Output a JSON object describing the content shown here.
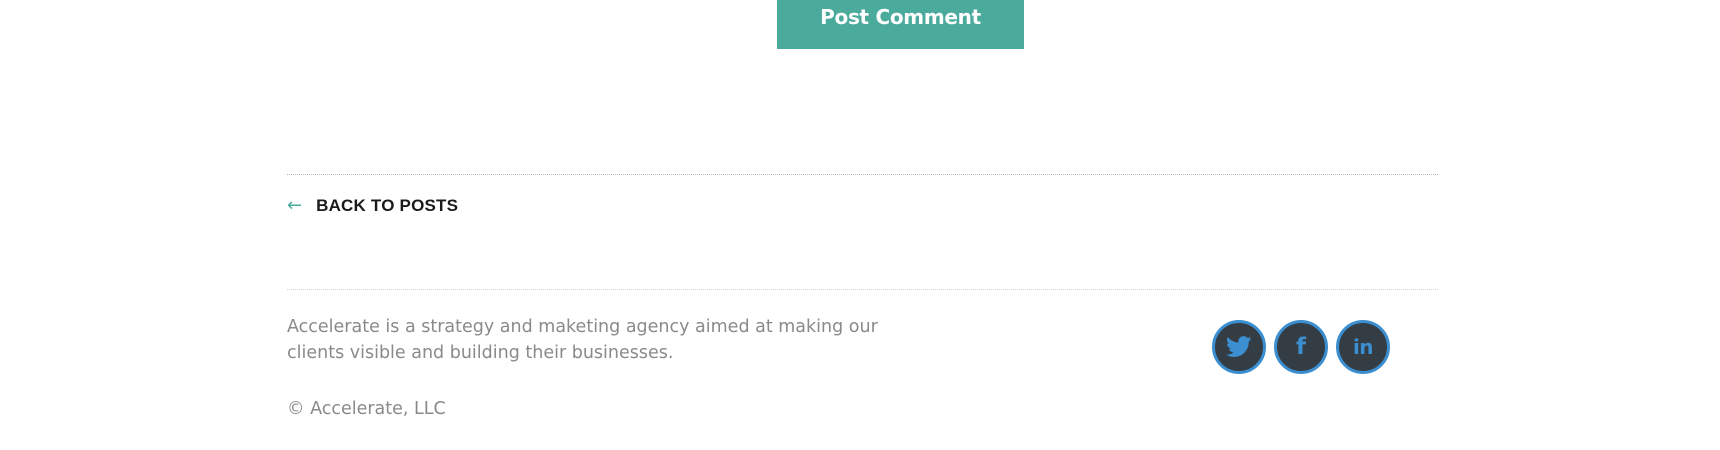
{
  "comment_form": {
    "submit_label": "Post Comment"
  },
  "post_nav": {
    "back_arrow": "←",
    "back_label": "BACK TO POSTS"
  },
  "footer": {
    "description": "Accelerate is a strategy and maketing agency aimed at making our clients visible and building their businesses.",
    "copyright": "© Accelerate, LLC",
    "social": [
      {
        "icon": "twitter-icon"
      },
      {
        "icon": "facebook-icon",
        "glyph": "f"
      },
      {
        "icon": "linkedin-icon",
        "glyph": "in"
      }
    ]
  },
  "colors": {
    "accent": "#4aaa9c",
    "social_bg": "#343c44",
    "social_ring": "#3b8fd0",
    "muted_text": "#8a8a8a"
  }
}
